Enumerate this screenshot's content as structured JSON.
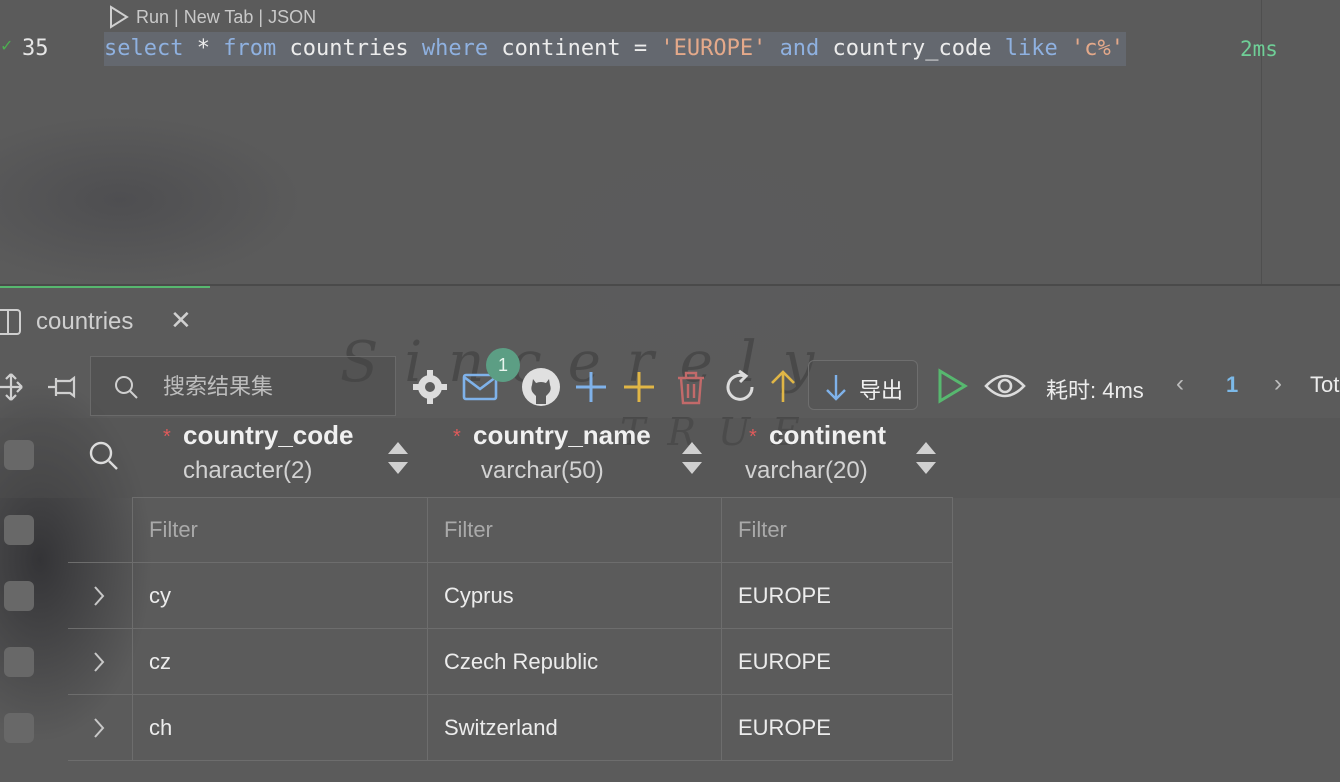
{
  "codelens": {
    "text": "Run | New Tab | JSON"
  },
  "editor": {
    "line_number": "35",
    "code_tokens": [
      {
        "t": "select",
        "c": "kw"
      },
      {
        "t": " * ",
        "c": "plain"
      },
      {
        "t": "from",
        "c": "kw"
      },
      {
        "t": " countries ",
        "c": "plain"
      },
      {
        "t": "where",
        "c": "kw"
      },
      {
        "t": " continent = ",
        "c": "plain"
      },
      {
        "t": "'EUROPE'",
        "c": "str"
      },
      {
        "t": " ",
        "c": "plain"
      },
      {
        "t": "and",
        "c": "kw"
      },
      {
        "t": " country_code ",
        "c": "plain"
      },
      {
        "t": "like",
        "c": "kw"
      },
      {
        "t": " ",
        "c": "plain"
      },
      {
        "t": "'c%'",
        "c": "str"
      }
    ],
    "duration": "2ms"
  },
  "tab": {
    "label": "countries"
  },
  "toolbar": {
    "search_placeholder": "搜索结果集",
    "mail_badge": "1",
    "export_label": "导出",
    "elapsed": "耗时: 4ms",
    "page": "1",
    "total_label": "Tot"
  },
  "columns": [
    {
      "name": "country_code",
      "type": "character(2)",
      "required": true
    },
    {
      "name": "country_name",
      "type": "varchar(50)",
      "required": true
    },
    {
      "name": "continent",
      "type": "varchar(20)",
      "required": true
    }
  ],
  "filter_placeholder": "Filter",
  "rows": [
    {
      "country_code": "cy",
      "country_name": "Cyprus",
      "continent": "EUROPE"
    },
    {
      "country_code": "cz",
      "country_name": "Czech Republic",
      "continent": "EUROPE"
    },
    {
      "country_code": "ch",
      "country_name": "Switzerland",
      "continent": "EUROPE"
    }
  ],
  "background_text": {
    "line1": "Sincerely",
    "line2": "TRUE"
  },
  "colors": {
    "accent_green": "#57b86f",
    "keyword": "#8fb1e0",
    "string": "#e4a98a",
    "required_star": "#e05a5a",
    "page_active": "#7cb9e8"
  }
}
